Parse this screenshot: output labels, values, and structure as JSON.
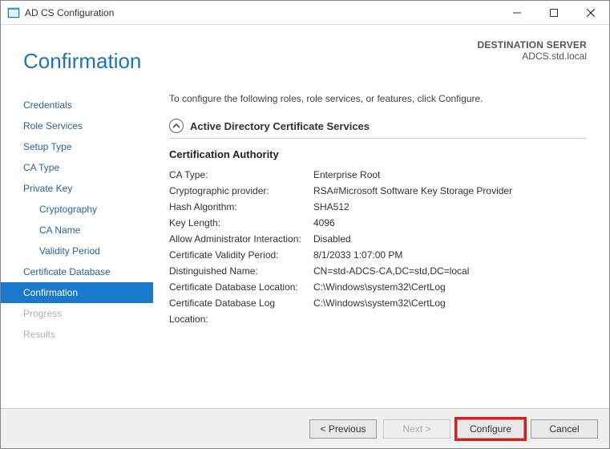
{
  "window": {
    "title": "AD CS Configuration"
  },
  "dest": {
    "label": "DESTINATION SERVER",
    "host": "ADCS.std.local"
  },
  "page_title": "Confirmation",
  "nav": [
    {
      "label": "Credentials",
      "indent": false,
      "selected": false,
      "disabled": false
    },
    {
      "label": "Role Services",
      "indent": false,
      "selected": false,
      "disabled": false
    },
    {
      "label": "Setup Type",
      "indent": false,
      "selected": false,
      "disabled": false
    },
    {
      "label": "CA Type",
      "indent": false,
      "selected": false,
      "disabled": false
    },
    {
      "label": "Private Key",
      "indent": false,
      "selected": false,
      "disabled": false
    },
    {
      "label": "Cryptography",
      "indent": true,
      "selected": false,
      "disabled": false
    },
    {
      "label": "CA Name",
      "indent": true,
      "selected": false,
      "disabled": false
    },
    {
      "label": "Validity Period",
      "indent": true,
      "selected": false,
      "disabled": false
    },
    {
      "label": "Certificate Database",
      "indent": false,
      "selected": false,
      "disabled": false
    },
    {
      "label": "Confirmation",
      "indent": false,
      "selected": true,
      "disabled": false
    },
    {
      "label": "Progress",
      "indent": false,
      "selected": false,
      "disabled": true
    },
    {
      "label": "Results",
      "indent": false,
      "selected": false,
      "disabled": true
    }
  ],
  "content": {
    "intro": "To configure the following roles, role services, or features, click Configure.",
    "section_title": "Active Directory Certificate Services",
    "subsection_title": "Certification Authority",
    "rows": [
      {
        "k": "CA Type:",
        "v": "Enterprise Root"
      },
      {
        "k": "Cryptographic provider:",
        "v": "RSA#Microsoft Software Key Storage Provider"
      },
      {
        "k": "Hash Algorithm:",
        "v": "SHA512"
      },
      {
        "k": "Key Length:",
        "v": "4096"
      },
      {
        "k": "Allow Administrator Interaction:",
        "v": "Disabled"
      },
      {
        "k": "Certificate Validity Period:",
        "v": "8/1/2033 1:07:00 PM"
      },
      {
        "k": "Distinguished Name:",
        "v": "CN=std-ADCS-CA,DC=std,DC=local"
      },
      {
        "k": "Certificate Database Location:",
        "v": "C:\\Windows\\system32\\CertLog"
      },
      {
        "k": "Certificate Database Log Location:",
        "v": "C:\\Windows\\system32\\CertLog"
      }
    ]
  },
  "buttons": {
    "previous": "< Previous",
    "next": "Next >",
    "configure": "Configure",
    "cancel": "Cancel"
  }
}
